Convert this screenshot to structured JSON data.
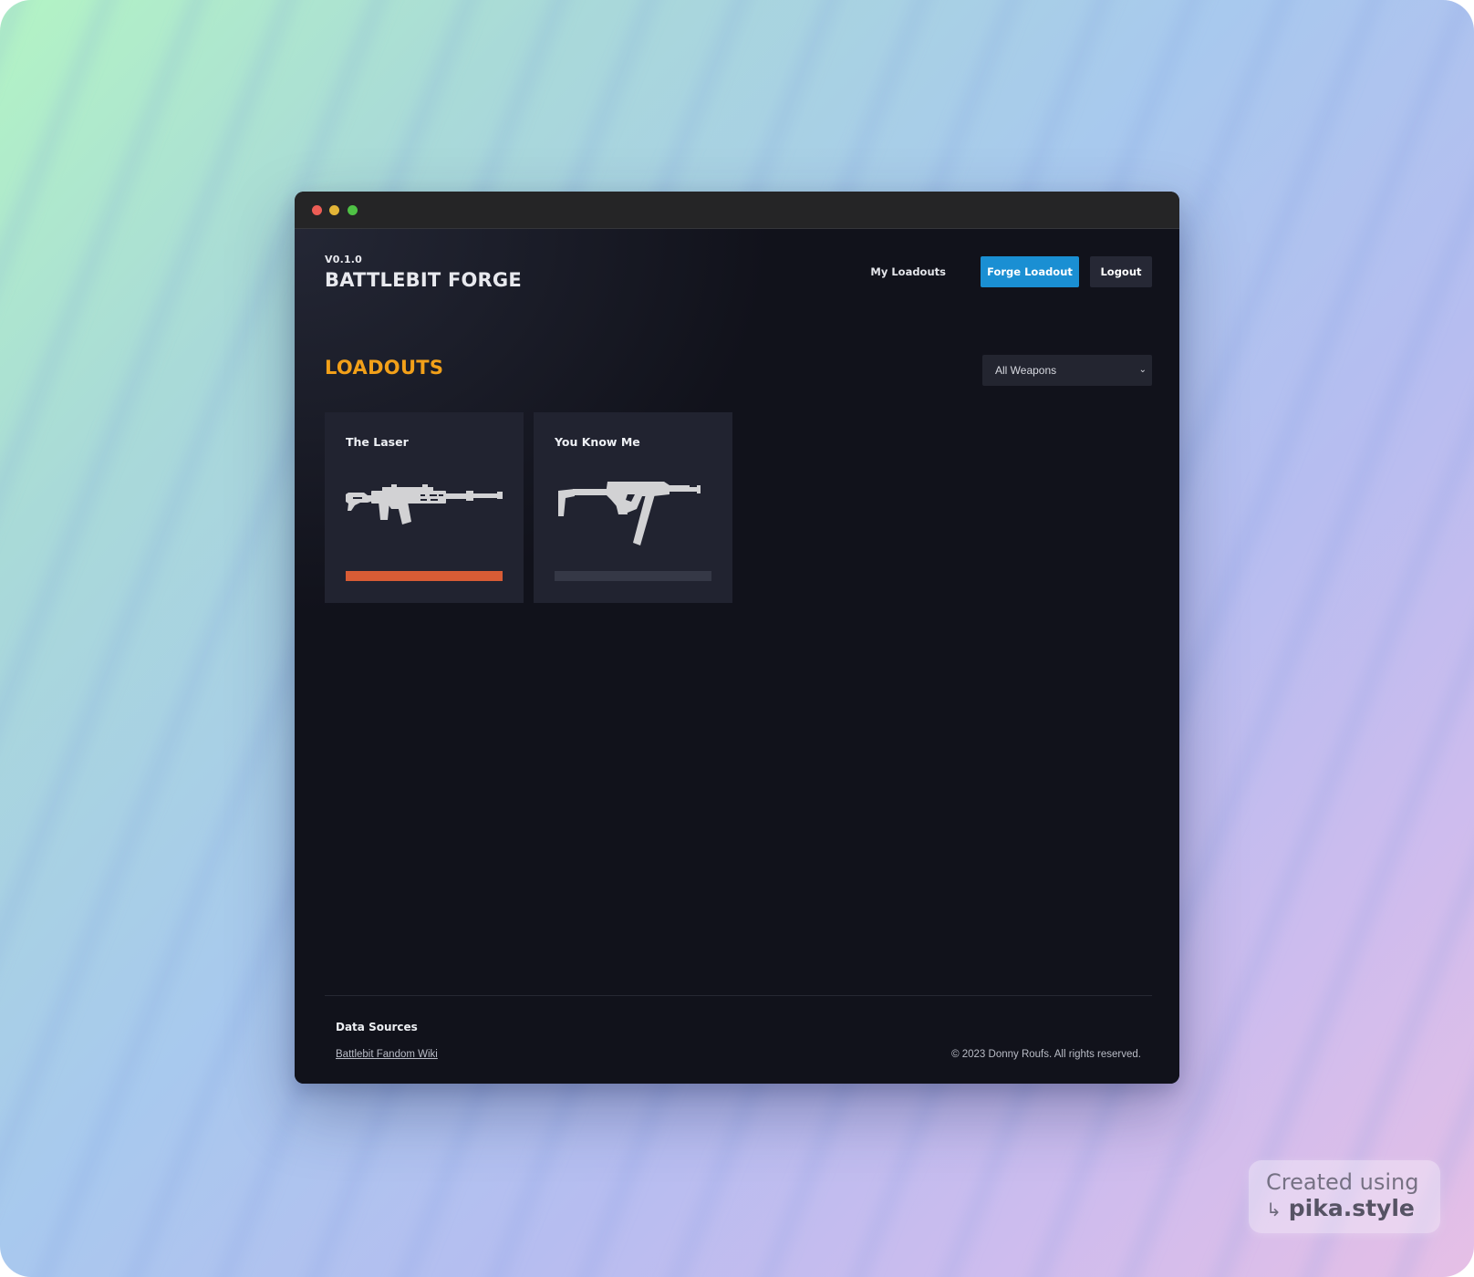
{
  "app": {
    "version": "V0.1.0",
    "title": "BATTLEBIT FORGE"
  },
  "nav": {
    "my_loadouts": "My Loadouts",
    "forge_loadout": "Forge Loadout",
    "logout": "Logout"
  },
  "main": {
    "section_title": "LOADOUTS",
    "filter": {
      "selected": "All Weapons",
      "chevron_icon": "chevron-down-icon"
    },
    "loadouts": [
      {
        "name": "The Laser",
        "weapon_icon": "assault-rifle-icon",
        "progress": 1.0
      },
      {
        "name": "You Know Me",
        "weapon_icon": "submachine-gun-icon",
        "progress": 0.0
      }
    ]
  },
  "footer": {
    "heading": "Data Sources",
    "link": "Battlebit Fandom Wiki",
    "copyright": "© 2023 Donny Roufs. All rights reserved."
  },
  "watermark": {
    "line1": "Created using",
    "line2": "pika.style",
    "arrow_icon": "return-arrow-icon"
  },
  "colors": {
    "accent": "#1a8fd3",
    "section_title": "#f2a019",
    "progress_fill": "#d85c35",
    "background": "#11121b",
    "card": "#212330"
  }
}
